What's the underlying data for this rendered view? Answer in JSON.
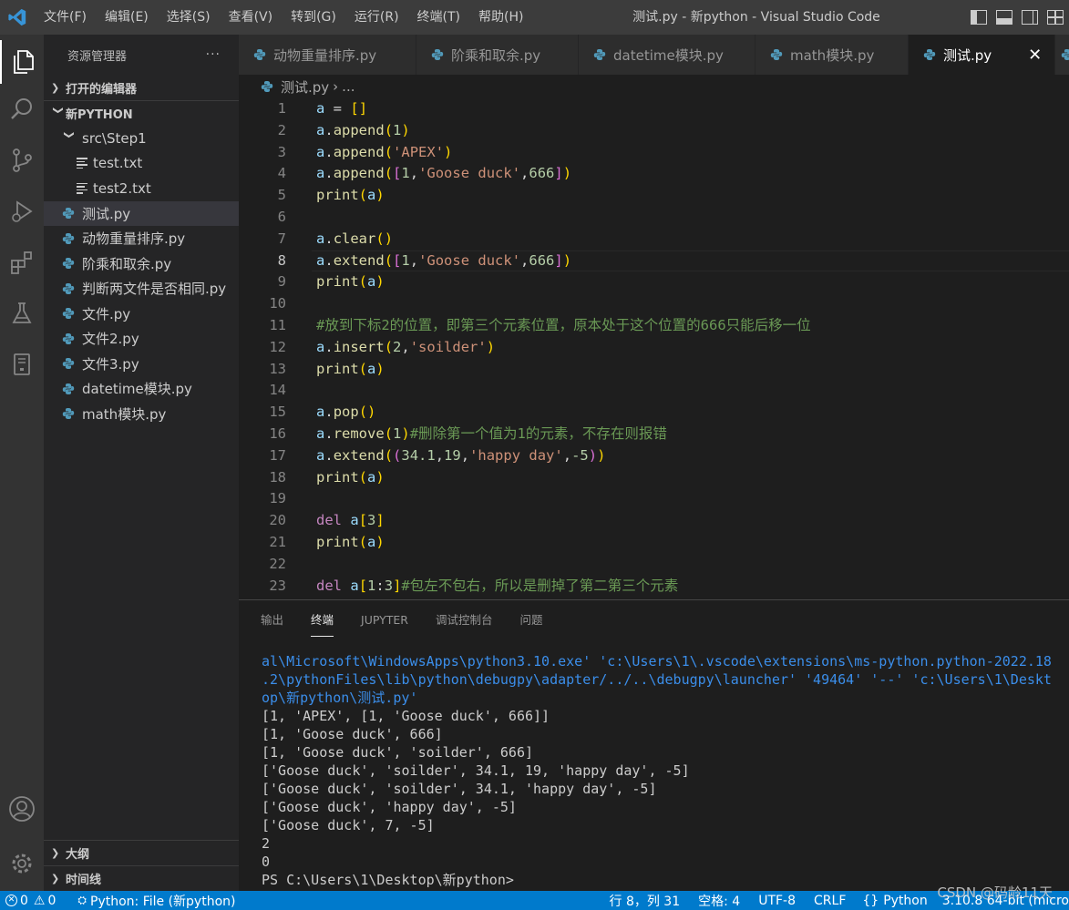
{
  "titlebar": {
    "menus": [
      "文件(F)",
      "编辑(E)",
      "选择(S)",
      "查看(V)",
      "转到(G)",
      "运行(R)",
      "终端(T)",
      "帮助(H)"
    ],
    "window_title": "测试.py - 新python - Visual Studio Code"
  },
  "sidebar": {
    "header": "资源管理器",
    "more": "···",
    "open_editors": "打开的编辑器",
    "project": "新PYTHON",
    "folder": "src\\Step1",
    "files": [
      {
        "name": "test.txt",
        "type": "txt"
      },
      {
        "name": "test2.txt",
        "type": "txt"
      },
      {
        "name": "测试.py",
        "type": "py"
      },
      {
        "name": "动物重量排序.py",
        "type": "py"
      },
      {
        "name": "阶乘和取余.py",
        "type": "py"
      },
      {
        "name": "判断两文件是否相同.py",
        "type": "py"
      },
      {
        "name": "文件.py",
        "type": "py"
      },
      {
        "name": "文件2.py",
        "type": "py"
      },
      {
        "name": "文件3.py",
        "type": "py"
      },
      {
        "name": "datetime模块.py",
        "type": "py"
      },
      {
        "name": "math模块.py",
        "type": "py"
      }
    ],
    "outline": "大纲",
    "timeline": "时间线"
  },
  "tabs": [
    {
      "label": "动物重量排序.py"
    },
    {
      "label": "阶乘和取余.py"
    },
    {
      "label": "datetime模块.py"
    },
    {
      "label": "math模块.py"
    },
    {
      "label": "测试.py"
    }
  ],
  "breadcrumb": {
    "file": "测试.py",
    "sep": "›",
    "rest": "..."
  },
  "editor": {
    "current_line": 8,
    "lines": [
      "a = []",
      "a.append(1)",
      "a.append('APEX')",
      "a.append([1,'Goose duck',666])",
      "print(a)",
      "",
      "a.clear()",
      "a.extend([1,'Goose duck',666])",
      "print(a)",
      "",
      "#放到下标2的位置，即第三个元素位置，原本处于这个位置的666只能后移一位",
      "a.insert(2,'soilder')",
      "print(a)",
      "",
      "a.pop()",
      "a.remove(1)#删除第一个值为1的元素，不存在则报错",
      "a.extend((34.1,19,'happy day',-5))",
      "print(a)",
      "",
      "del a[3]",
      "print(a)",
      "",
      "del a[1:3]#包左不包右，所以是删掉了第二第三个元素"
    ]
  },
  "panel": {
    "tabs": [
      "输出",
      "终端",
      "JUPYTER",
      "调试控制台",
      "问题"
    ],
    "active_tab": "终端",
    "terminal_command": [
      "al\\Microsoft\\WindowsApps\\python3.10.exe' 'c:\\Users\\1\\.vscode\\extensions\\ms-python.python-2022.18",
      ".2\\pythonFiles\\lib\\python\\debugpy\\adapter/../..\\debugpy\\launcher' '49464' '--' 'c:\\Users\\1\\Deskt",
      "op\\新python\\测试.py'"
    ],
    "terminal_output": [
      "[1, 'APEX', [1, 'Goose duck', 666]]",
      "[1, 'Goose duck', 666]",
      "[1, 'Goose duck', 'soilder', 666]",
      "['Goose duck', 'soilder', 34.1, 19, 'happy day', -5]",
      "['Goose duck', 'soilder', 34.1, 'happy day', -5]",
      "['Goose duck', 'happy day', -5]",
      "['Goose duck', 7, -5]",
      "2",
      "0",
      "PS C:\\Users\\1\\Desktop\\新python>"
    ]
  },
  "statusbar": {
    "errors": "0",
    "warnings": "0",
    "python_file": "Python: File (新python)",
    "position": "行 8，列 31",
    "spaces": "空格: 4",
    "encoding": "UTF-8",
    "eol": "CRLF",
    "language": "Python",
    "interpreter": "3.10.8 64-bit (micro"
  },
  "watermark": "CSDN @码龄11天",
  "colors": {
    "keyword": "#c586c0",
    "variable": "#9cdcfe",
    "function": "#dcdcaa",
    "string": "#ce9178",
    "number": "#b5cea8",
    "comment": "#6a9955",
    "bracket1": "#ffd700",
    "bracket2": "#da70d6",
    "bracket3": "#179fff",
    "accent": "#007acc",
    "python_icon": "#519aba"
  }
}
